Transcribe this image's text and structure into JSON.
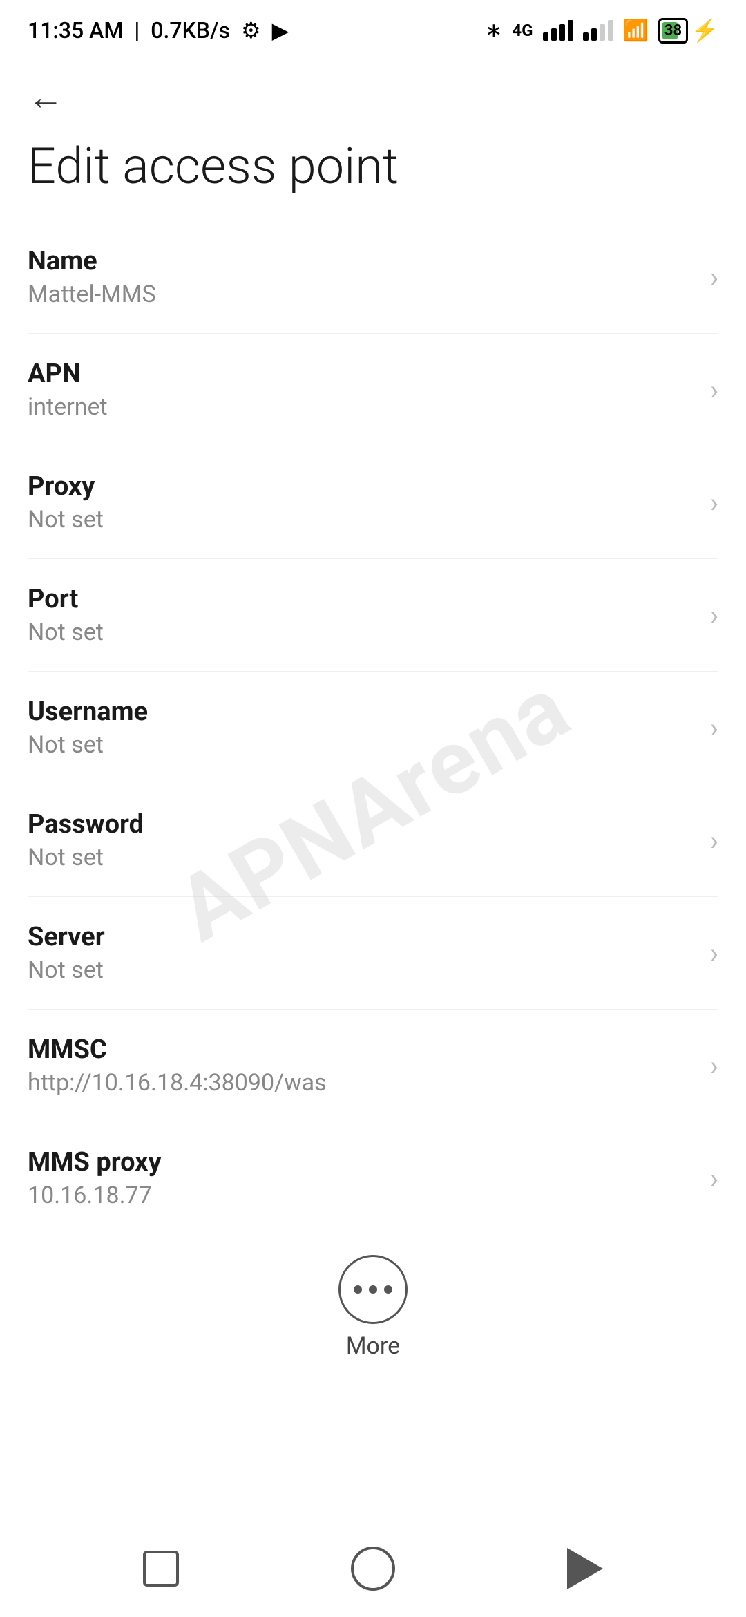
{
  "statusBar": {
    "time": "11:35 AM",
    "speed": "0.7KB/s"
  },
  "page": {
    "title": "Edit access point",
    "back_label": "Back"
  },
  "settings": [
    {
      "label": "Name",
      "value": "Mattel-MMS"
    },
    {
      "label": "APN",
      "value": "internet"
    },
    {
      "label": "Proxy",
      "value": "Not set"
    },
    {
      "label": "Port",
      "value": "Not set"
    },
    {
      "label": "Username",
      "value": "Not set"
    },
    {
      "label": "Password",
      "value": "Not set"
    },
    {
      "label": "Server",
      "value": "Not set"
    },
    {
      "label": "MMSC",
      "value": "http://10.16.18.4:38090/was"
    },
    {
      "label": "MMS proxy",
      "value": "10.16.18.77"
    }
  ],
  "more": {
    "label": "More"
  },
  "watermark": "APNArena",
  "battery": {
    "level": "38"
  }
}
